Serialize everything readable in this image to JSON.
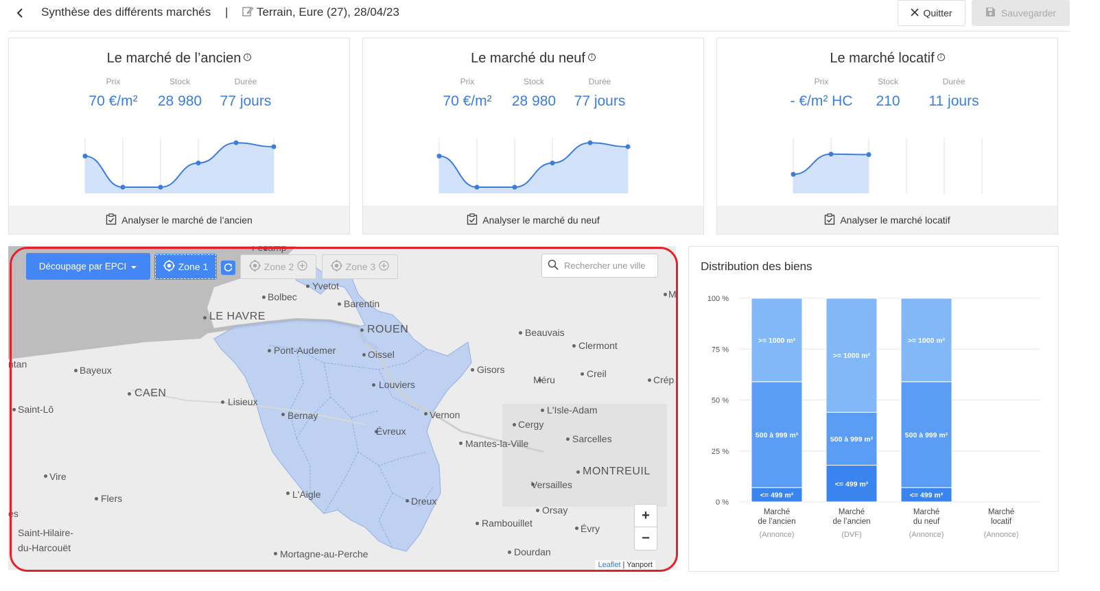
{
  "header": {
    "title": "Synthèse des différents marchés",
    "separator": "|",
    "subtitle": "Terrain, Eure (27), 28/04/23",
    "quit_label": "Quitter",
    "save_label": "Sauvegarder"
  },
  "cards": [
    {
      "title": "Le marché de l’ancien",
      "labels": [
        "Prix",
        "Stock",
        "Durée"
      ],
      "values": [
        "70 €/m²",
        "28 980",
        "77 jours"
      ],
      "trend": [
        0.63,
        0.0,
        0.0,
        0.49,
        0.9,
        0.82
      ],
      "footer": "Analyser le marché de l’ancien"
    },
    {
      "title": "Le marché du neuf",
      "labels": [
        "Prix",
        "Stock",
        "Durée"
      ],
      "values": [
        "70 €/m²",
        "28 980",
        "77 jours"
      ],
      "trend": [
        0.63,
        0.0,
        0.0,
        0.49,
        0.9,
        0.82
      ],
      "footer": "Analyser le marché du neuf"
    },
    {
      "title": "Le marché locatif",
      "labels": [
        "Prix",
        "Stock",
        "Durée"
      ],
      "values": [
        "- €/m² HC",
        "210",
        "11 jours"
      ],
      "trend": [
        0.26,
        0.67,
        0.66
      ],
      "footer": "Analyser le marché locatif"
    }
  ],
  "map": {
    "epci_button": "Découpage par EPCI",
    "zone1": "Zone 1",
    "zone2": "Zone 2",
    "zone3": "Zone 3",
    "search_placeholder": "Rechercher une ville",
    "zoom_in": "+",
    "zoom_out": "−",
    "attribution_link": "Leaflet",
    "attribution_sep": " | ",
    "attribution_text": "Yanport",
    "places": [
      {
        "name": "Fécamp"
      },
      {
        "name": "Yvetot"
      },
      {
        "name": "Bolbec"
      },
      {
        "name": "Barentin"
      },
      {
        "name": "LE HAVRE"
      },
      {
        "name": "ROUEN"
      },
      {
        "name": "Beauvais"
      },
      {
        "name": "Clermont"
      },
      {
        "name": "Pont-Audemer"
      },
      {
        "name": "Oissel"
      },
      {
        "name": "ntan"
      },
      {
        "name": "Bayeux"
      },
      {
        "name": "Gisors"
      },
      {
        "name": "Creil"
      },
      {
        "name": "Méru"
      },
      {
        "name": "Crép"
      },
      {
        "name": "CAEN"
      },
      {
        "name": "Lisieux"
      },
      {
        "name": "Louviers"
      },
      {
        "name": "Saint-Lô"
      },
      {
        "name": "L'Isle-Adam"
      },
      {
        "name": "Bernay"
      },
      {
        "name": "Vernon"
      },
      {
        "name": "Cergy"
      },
      {
        "name": "Évreux"
      },
      {
        "name": "Sarcelles"
      },
      {
        "name": "Mantes-la-Ville"
      },
      {
        "name": "MONTREUIL"
      },
      {
        "name": "Vire"
      },
      {
        "name": "Versailles"
      },
      {
        "name": "L'Aigle"
      },
      {
        "name": "Flers"
      },
      {
        "name": "Dreux"
      },
      {
        "name": "Orsay"
      },
      {
        "name": "es"
      },
      {
        "name": "Rambouillet"
      },
      {
        "name": "Évry"
      },
      {
        "name": "Saint-Hilaire-"
      },
      {
        "name": "du-Harcouët"
      },
      {
        "name": "Mortagne-au-Perche"
      },
      {
        "name": "Dourdan"
      },
      {
        "name": "M"
      }
    ]
  },
  "chart_data": {
    "type": "bar",
    "title": "Distribution des biens",
    "stacked": true,
    "y_ticks": [
      "100 %",
      "75 %",
      "50 %",
      "25 %",
      "0 %"
    ],
    "ylim": [
      0,
      100
    ],
    "categories": [
      {
        "line1": "Marché",
        "line2": "de l’ancien",
        "source": "(Annonce)"
      },
      {
        "line1": "Marché",
        "line2": "de l’ancien",
        "source": "(DVF)"
      },
      {
        "line1": "Marché",
        "line2": "du neuf",
        "source": "(Annonce)"
      },
      {
        "line1": "Marché",
        "line2": "locatif",
        "source": "(Annonce)"
      }
    ],
    "series": [
      {
        "name": "<= 499 m²",
        "color": "#3a84f0",
        "values": [
          7,
          18,
          7,
          0
        ]
      },
      {
        "name": "500 à 999 m²",
        "color": "#5b9cf5",
        "values": [
          52,
          26,
          52,
          0
        ]
      },
      {
        "name": ">= 1000 m²",
        "color": "#82b8f8",
        "values": [
          41,
          56,
          41,
          0
        ]
      }
    ]
  },
  "colors": {
    "accent": "#3b7ddd",
    "button_blue": "#4287f5",
    "highlight": "#e5202b",
    "region_fill": "#b7ccf2"
  }
}
